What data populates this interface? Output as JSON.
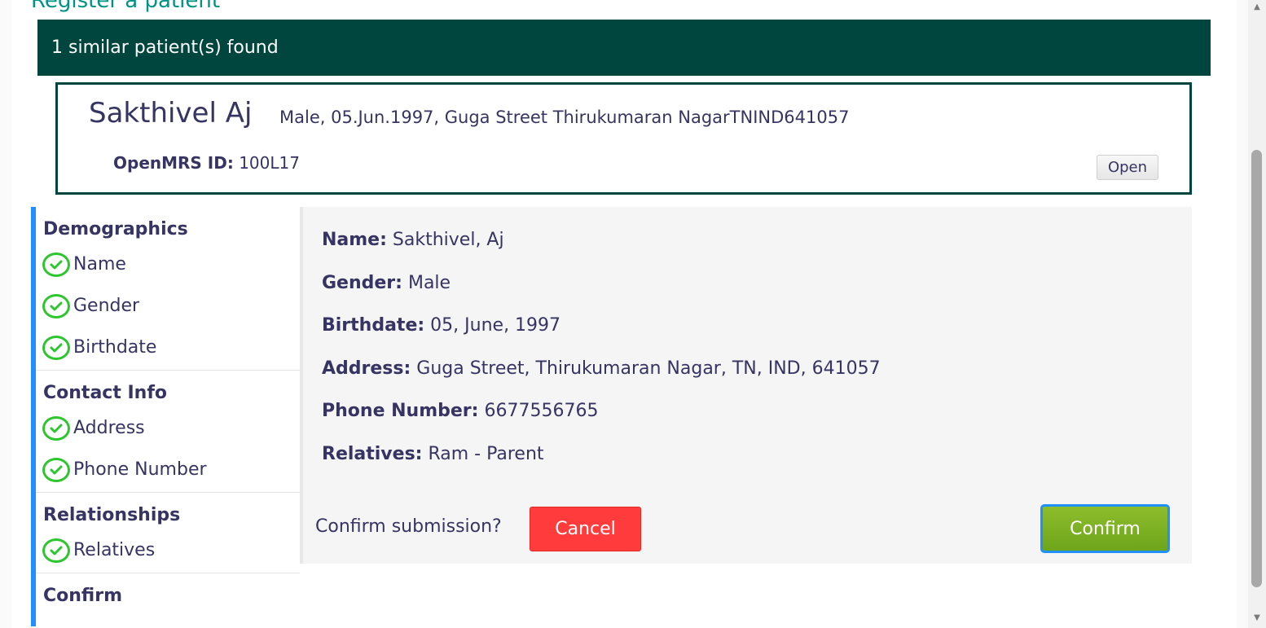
{
  "page": {
    "heading": "Register a patient"
  },
  "similar": {
    "banner": "1 similar patient(s) found",
    "name": "Sakthivel Aj",
    "details": "Male, 05.Jun.1997, Guga Street Thirukumaran NagarTNIND641057",
    "id_label": "OpenMRS ID:",
    "id_value": "100L17",
    "open_label": "Open"
  },
  "sidebar": {
    "sections": [
      {
        "title": "Demographics",
        "steps": [
          "Name",
          "Gender",
          "Birthdate"
        ]
      },
      {
        "title": "Contact Info",
        "steps": [
          "Address",
          "Phone Number"
        ]
      },
      {
        "title": "Relationships",
        "steps": [
          "Relatives"
        ]
      },
      {
        "title": "Confirm",
        "steps": []
      }
    ]
  },
  "summary": {
    "fields": [
      {
        "label": "Name:",
        "value": "Sakthivel, Aj"
      },
      {
        "label": "Gender:",
        "value": "Male"
      },
      {
        "label": "Birthdate:",
        "value": "05, June, 1997"
      },
      {
        "label": "Address:",
        "value": "Guga Street, Thirukumaran Nagar, TN, IND, 641057"
      },
      {
        "label": "Phone Number:",
        "value": "6677556765"
      },
      {
        "label": "Relatives:",
        "value": "Ram - Parent"
      }
    ]
  },
  "actions": {
    "question": "Confirm submission?",
    "cancel": "Cancel",
    "confirm": "Confirm"
  },
  "colors": {
    "banner": "#00463f",
    "heading": "#009384",
    "check": "#2ec62e",
    "cancel": "#ff3b3b",
    "confirm": "#7ab124",
    "accent": "#1e90ff"
  },
  "icons": {
    "step_complete": "check-circle-icon"
  }
}
